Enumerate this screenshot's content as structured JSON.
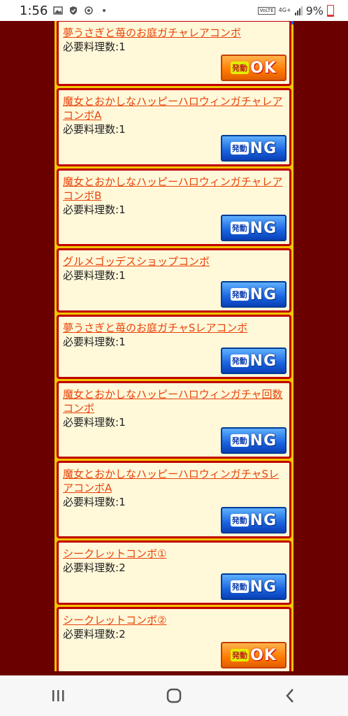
{
  "status_bar": {
    "time": "1:56",
    "network": "4G+",
    "battery": "9%",
    "volte": "VoLTE"
  },
  "combos": [
    {
      "title": "夢うさぎと苺のお庭ガチャレアコンボ",
      "req_label": "必要料理数:",
      "req_value": "1",
      "badge_small": "発動",
      "status": "OK"
    },
    {
      "title": "魔女とおかしなハッピーハロウィンガチャレアコンボA",
      "req_label": "必要料理数:",
      "req_value": "1",
      "badge_small": "発動",
      "status": "NG"
    },
    {
      "title": "魔女とおかしなハッピーハロウィンガチャレアコンボB",
      "req_label": "必要料理数:",
      "req_value": "1",
      "badge_small": "発動",
      "status": "NG"
    },
    {
      "title": "グルメゴッデスショップコンボ",
      "req_label": "必要料理数:",
      "req_value": "1",
      "badge_small": "発動",
      "status": "NG"
    },
    {
      "title": "夢うさぎと苺のお庭ガチャSレアコンボ",
      "req_label": "必要料理数:",
      "req_value": "1",
      "badge_small": "発動",
      "status": "NG"
    },
    {
      "title": "魔女とおかしなハッピーハロウィンガチャ回数コンボ",
      "req_label": "必要料理数:",
      "req_value": "1",
      "badge_small": "発動",
      "status": "NG"
    },
    {
      "title": "魔女とおかしなハッピーハロウィンガチャSレアコンボA",
      "req_label": "必要料理数:",
      "req_value": "1",
      "badge_small": "発動",
      "status": "NG"
    },
    {
      "title": "シークレットコンボ①",
      "req_label": "必要料理数:",
      "req_value": "2",
      "badge_small": "発動",
      "status": "NG"
    },
    {
      "title": "シークレットコンボ②",
      "req_label": "必要料理数:",
      "req_value": "2",
      "badge_small": "発動",
      "status": "OK"
    }
  ],
  "colors": {
    "background": "#6b0000",
    "card_border": "#c00000",
    "card_bg": "#fff8d9",
    "title_link": "#e8440b",
    "ok_badge": "#ff7a00",
    "ng_badge": "#1a64e0"
  },
  "nav": {
    "recents_icon": "recents-icon",
    "home_icon": "home-icon",
    "back_icon": "back-icon"
  }
}
